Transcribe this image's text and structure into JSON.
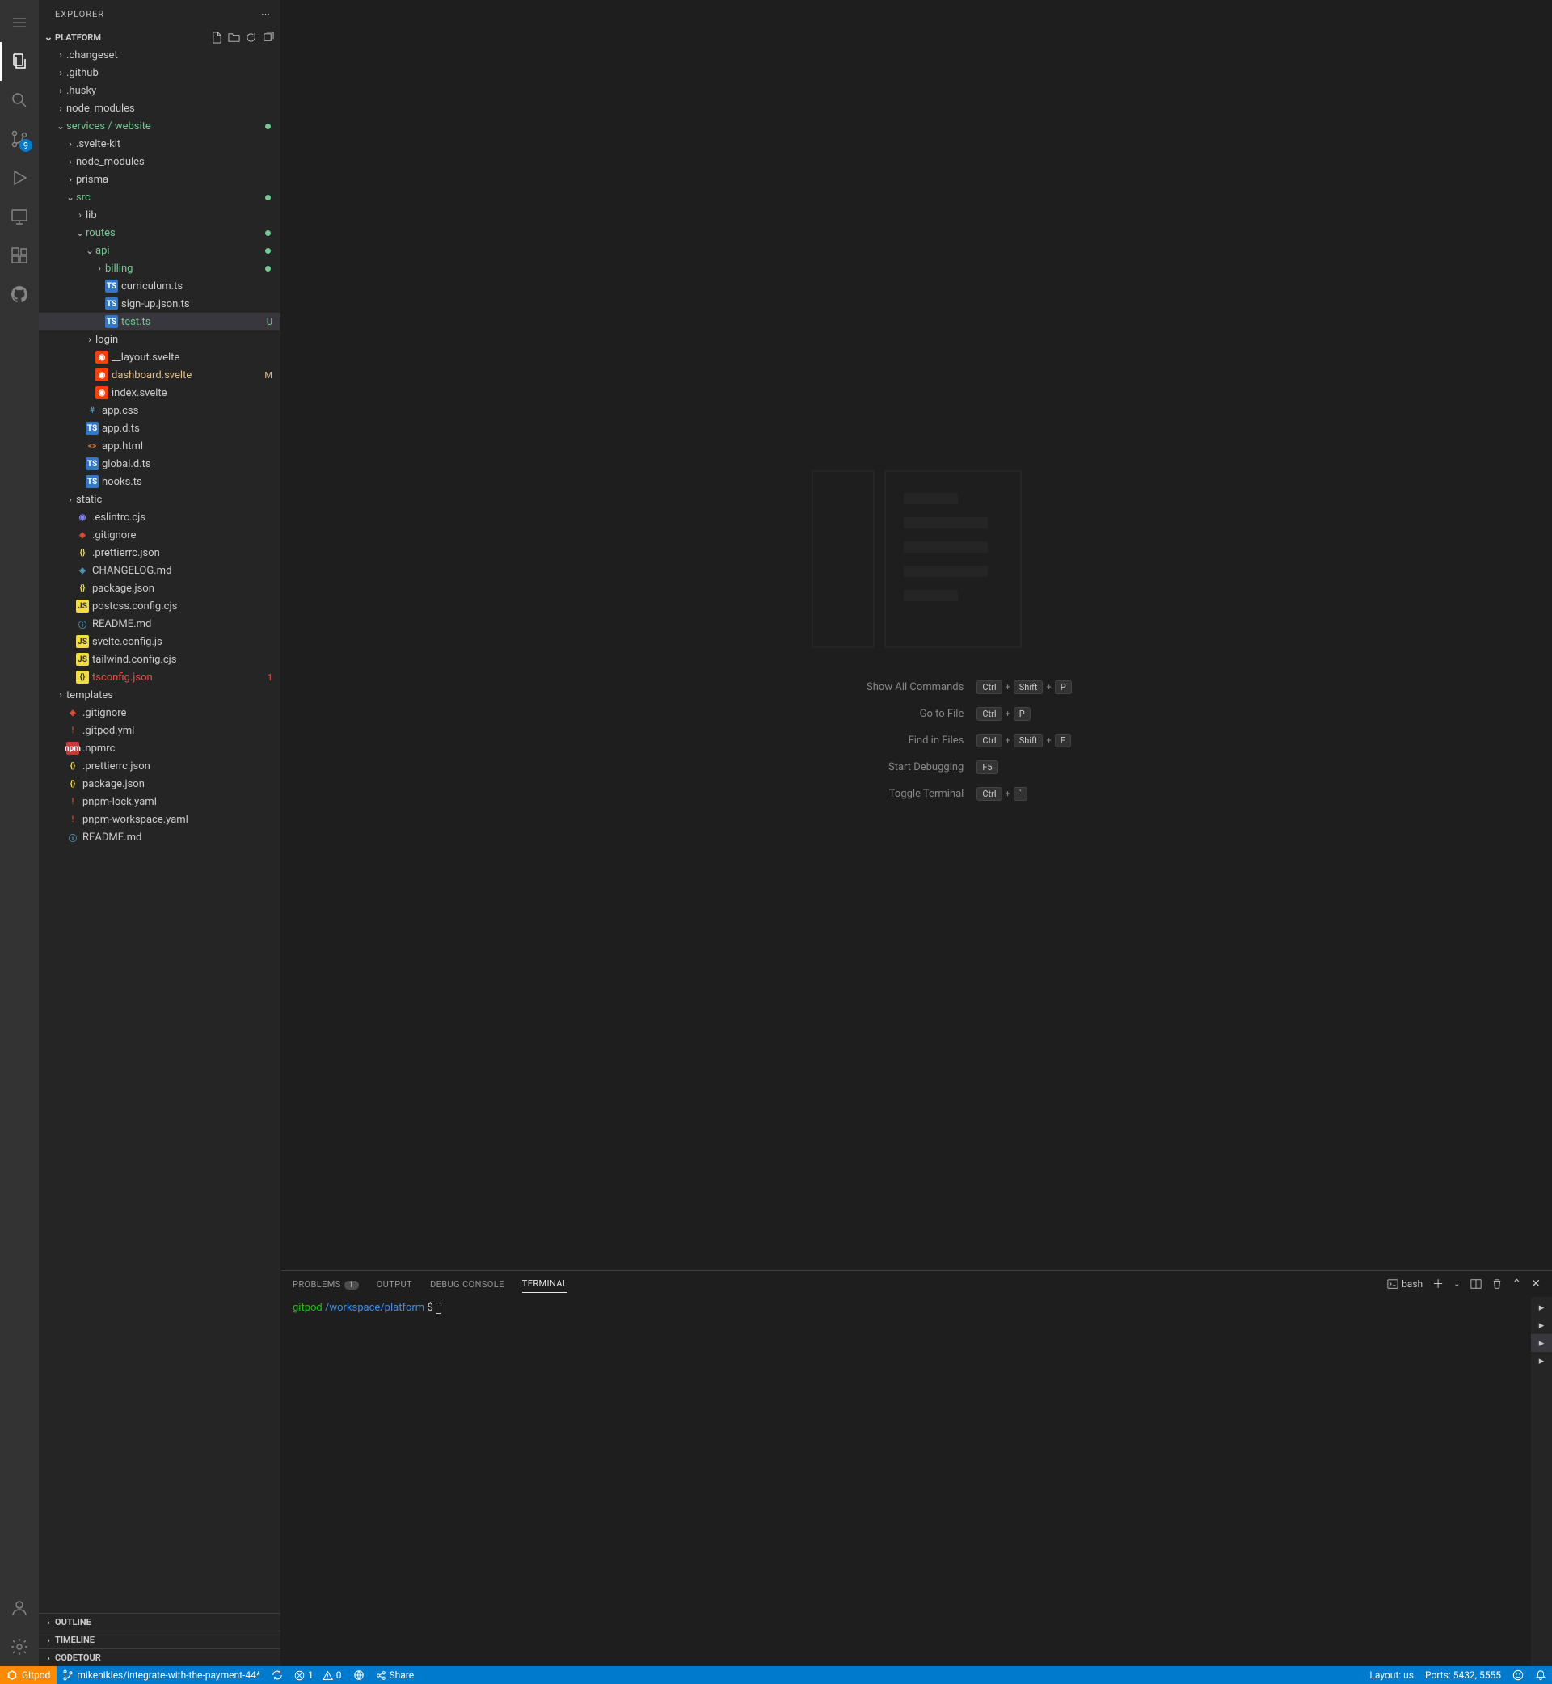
{
  "sidebar": {
    "title": "EXPLORER",
    "section": "PLATFORM",
    "bottomSections": [
      "OUTLINE",
      "TIMELINE",
      "CODETOUR"
    ]
  },
  "scmBadge": "9",
  "tree": [
    {
      "l": 1,
      "t": "folder",
      "open": false,
      "name": ".changeset"
    },
    {
      "l": 1,
      "t": "folder",
      "open": false,
      "name": ".github"
    },
    {
      "l": 1,
      "t": "folder",
      "open": false,
      "name": ".husky"
    },
    {
      "l": 1,
      "t": "folder",
      "open": false,
      "name": "node_modules"
    },
    {
      "l": 1,
      "t": "folder",
      "open": true,
      "name": "services / website",
      "cls": "git-new",
      "dot": true
    },
    {
      "l": 2,
      "t": "folder",
      "open": false,
      "name": ".svelte-kit"
    },
    {
      "l": 2,
      "t": "folder",
      "open": false,
      "name": "node_modules"
    },
    {
      "l": 2,
      "t": "folder",
      "open": false,
      "name": "prisma"
    },
    {
      "l": 2,
      "t": "folder",
      "open": true,
      "name": "src",
      "cls": "git-new",
      "dot": true
    },
    {
      "l": 3,
      "t": "folder",
      "open": false,
      "name": "lib"
    },
    {
      "l": 3,
      "t": "folder",
      "open": true,
      "name": "routes",
      "cls": "git-new",
      "dot": true
    },
    {
      "l": 4,
      "t": "folder",
      "open": true,
      "name": "api",
      "cls": "git-new",
      "dot": true
    },
    {
      "l": 5,
      "t": "folder",
      "open": false,
      "name": "billing",
      "cls": "git-new",
      "dot": true
    },
    {
      "l": 5,
      "t": "file",
      "ic": "ts",
      "name": "curriculum.ts"
    },
    {
      "l": 5,
      "t": "file",
      "ic": "ts",
      "name": "sign-up.json.ts"
    },
    {
      "l": 5,
      "t": "file",
      "ic": "ts",
      "name": "test.ts",
      "sel": true,
      "status": "U",
      "stcls": "untracked",
      "cls": "git-new"
    },
    {
      "l": 4,
      "t": "folder",
      "open": false,
      "name": "login"
    },
    {
      "l": 4,
      "t": "file",
      "ic": "svelte",
      "name": "__layout.svelte"
    },
    {
      "l": 4,
      "t": "file",
      "ic": "svelte",
      "name": "dashboard.svelte",
      "status": "M",
      "stcls": "modified",
      "cls": "dot-git-m"
    },
    {
      "l": 4,
      "t": "file",
      "ic": "svelte",
      "name": "index.svelte"
    },
    {
      "l": 3,
      "t": "file",
      "ic": "css",
      "name": "app.css"
    },
    {
      "l": 3,
      "t": "file",
      "ic": "ts",
      "name": "app.d.ts"
    },
    {
      "l": 3,
      "t": "file",
      "ic": "html",
      "name": "app.html"
    },
    {
      "l": 3,
      "t": "file",
      "ic": "ts",
      "name": "global.d.ts"
    },
    {
      "l": 3,
      "t": "file",
      "ic": "ts",
      "name": "hooks.ts"
    },
    {
      "l": 2,
      "t": "folder",
      "open": false,
      "name": "static"
    },
    {
      "l": 2,
      "t": "file",
      "ic": "eslint",
      "name": ".eslintrc.cjs"
    },
    {
      "l": 2,
      "t": "file",
      "ic": "git",
      "name": ".gitignore"
    },
    {
      "l": 2,
      "t": "file",
      "ic": "brace",
      "name": ".prettierrc.json"
    },
    {
      "l": 2,
      "t": "file",
      "ic": "md",
      "name": "CHANGELOG.md"
    },
    {
      "l": 2,
      "t": "file",
      "ic": "brace",
      "name": "package.json"
    },
    {
      "l": 2,
      "t": "file",
      "ic": "js",
      "name": "postcss.config.cjs"
    },
    {
      "l": 2,
      "t": "file",
      "ic": "readme",
      "name": "README.md"
    },
    {
      "l": 2,
      "t": "file",
      "ic": "js",
      "name": "svelte.config.js"
    },
    {
      "l": 2,
      "t": "file",
      "ic": "js",
      "name": "tailwind.config.cjs"
    },
    {
      "l": 2,
      "t": "file",
      "ic": "json",
      "name": "tsconfig.json",
      "cls": "error-file",
      "status": "1",
      "stcls": "error-file"
    },
    {
      "l": 1,
      "t": "folder",
      "open": false,
      "name": "templates"
    },
    {
      "l": 1,
      "t": "file",
      "ic": "git",
      "name": ".gitignore"
    },
    {
      "l": 1,
      "t": "file",
      "ic": "yml",
      "name": ".gitpod.yml"
    },
    {
      "l": 1,
      "t": "file",
      "ic": "npm",
      "name": ".npmrc"
    },
    {
      "l": 1,
      "t": "file",
      "ic": "brace",
      "name": ".prettierrc.json"
    },
    {
      "l": 1,
      "t": "file",
      "ic": "brace",
      "name": "package.json"
    },
    {
      "l": 1,
      "t": "file",
      "ic": "yml",
      "name": "pnpm-lock.yaml"
    },
    {
      "l": 1,
      "t": "file",
      "ic": "yml",
      "name": "pnpm-workspace.yaml"
    },
    {
      "l": 1,
      "t": "file",
      "ic": "readme",
      "name": "README.md"
    }
  ],
  "shortcuts": [
    {
      "label": "Show All Commands",
      "keys": [
        "Ctrl",
        "Shift",
        "P"
      ]
    },
    {
      "label": "Go to File",
      "keys": [
        "Ctrl",
        "P"
      ]
    },
    {
      "label": "Find in Files",
      "keys": [
        "Ctrl",
        "Shift",
        "F"
      ]
    },
    {
      "label": "Start Debugging",
      "keys": [
        "F5"
      ]
    },
    {
      "label": "Toggle Terminal",
      "keys": [
        "Ctrl",
        "`"
      ]
    }
  ],
  "panel": {
    "tabs": [
      {
        "label": "PROBLEMS",
        "badge": "1"
      },
      {
        "label": "OUTPUT"
      },
      {
        "label": "DEBUG CONSOLE"
      },
      {
        "label": "TERMINAL",
        "active": true
      }
    ],
    "termName": "bash",
    "promptHost": "gitpod",
    "promptPath": "/workspace/platform",
    "promptSymbol": "$"
  },
  "status": {
    "gitpod": "Gitpod",
    "branch": "mikenikles/integrate-with-the-payment-44*",
    "errors": "1",
    "warnings": "0",
    "share": "Share",
    "layout": "Layout: us",
    "ports": "Ports: 5432, 5555"
  }
}
